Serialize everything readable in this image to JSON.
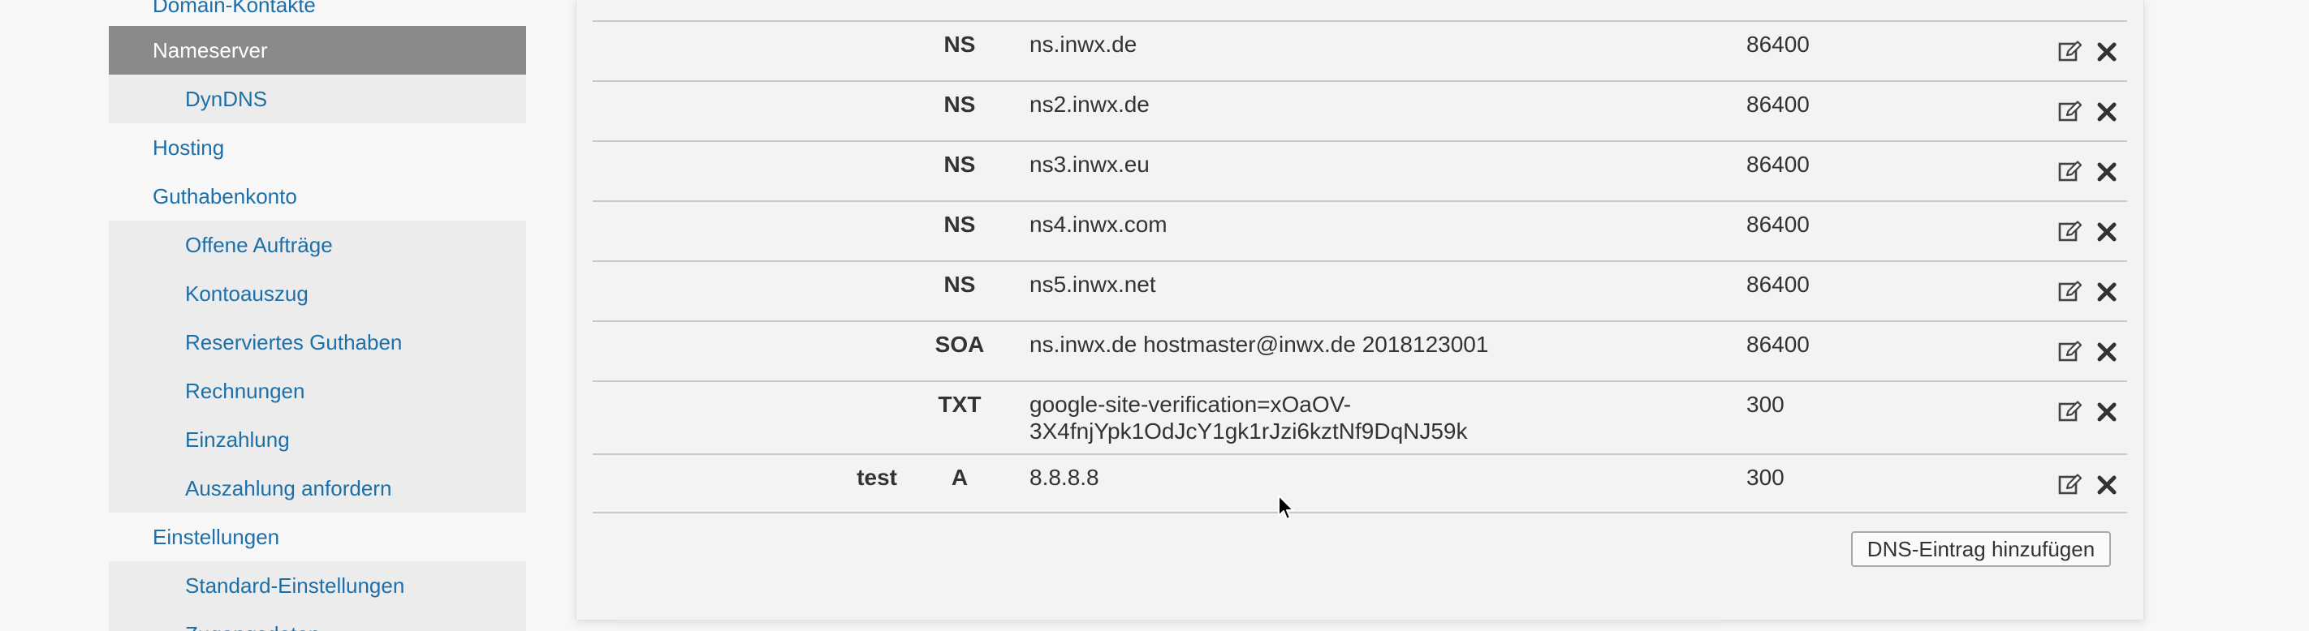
{
  "sidebar": {
    "items": [
      {
        "label": "Domain-Kontakte",
        "level": 1,
        "active": false
      },
      {
        "label": "Nameserver",
        "level": 1,
        "active": true
      },
      {
        "label": "DynDNS",
        "level": 2,
        "active": false
      },
      {
        "label": "Hosting",
        "level": 1,
        "active": false
      },
      {
        "label": "Guthabenkonto",
        "level": 1,
        "active": false
      },
      {
        "label": "Offene Aufträge",
        "level": 2,
        "active": false
      },
      {
        "label": "Kontoauszug",
        "level": 2,
        "active": false
      },
      {
        "label": "Reserviertes Guthaben",
        "level": 2,
        "active": false
      },
      {
        "label": "Rechnungen",
        "level": 2,
        "active": false
      },
      {
        "label": "Einzahlung",
        "level": 2,
        "active": false
      },
      {
        "label": "Auszahlung anfordern",
        "level": 2,
        "active": false
      },
      {
        "label": "Einstellungen",
        "level": 1,
        "active": false
      },
      {
        "label": "Standard-Einstellungen",
        "level": 2,
        "active": false
      },
      {
        "label": "Zugangsdaten",
        "level": 2,
        "active": false
      }
    ]
  },
  "dns": {
    "records": [
      {
        "name": "",
        "type": "NS",
        "value": "ns.inwx.de",
        "ttl": "86400"
      },
      {
        "name": "",
        "type": "NS",
        "value": "ns2.inwx.de",
        "ttl": "86400"
      },
      {
        "name": "",
        "type": "NS",
        "value": "ns3.inwx.eu",
        "ttl": "86400"
      },
      {
        "name": "",
        "type": "NS",
        "value": "ns4.inwx.com",
        "ttl": "86400"
      },
      {
        "name": "",
        "type": "NS",
        "value": "ns5.inwx.net",
        "ttl": "86400"
      },
      {
        "name": "",
        "type": "SOA",
        "value": "ns.inwx.de hostmaster@inwx.de 2018123001",
        "ttl": "86400"
      },
      {
        "name": "",
        "type": "TXT",
        "value": "google-site-verification=xOaOV-",
        "value2": "3X4fnjYpk1OdJcY1gk1rJzi6kztNf9DqNJ59k",
        "ttl": "300"
      },
      {
        "name": "test",
        "type": "A",
        "value": "8.8.8.8",
        "ttl": "300"
      }
    ],
    "add_button_label": "DNS-Eintrag hinzufügen"
  },
  "icons": {
    "edit": "edit-icon",
    "delete": "delete-icon"
  },
  "colors": {
    "link": "#1d6fa8",
    "active_bg": "#8a8a8a",
    "text": "#333333"
  }
}
